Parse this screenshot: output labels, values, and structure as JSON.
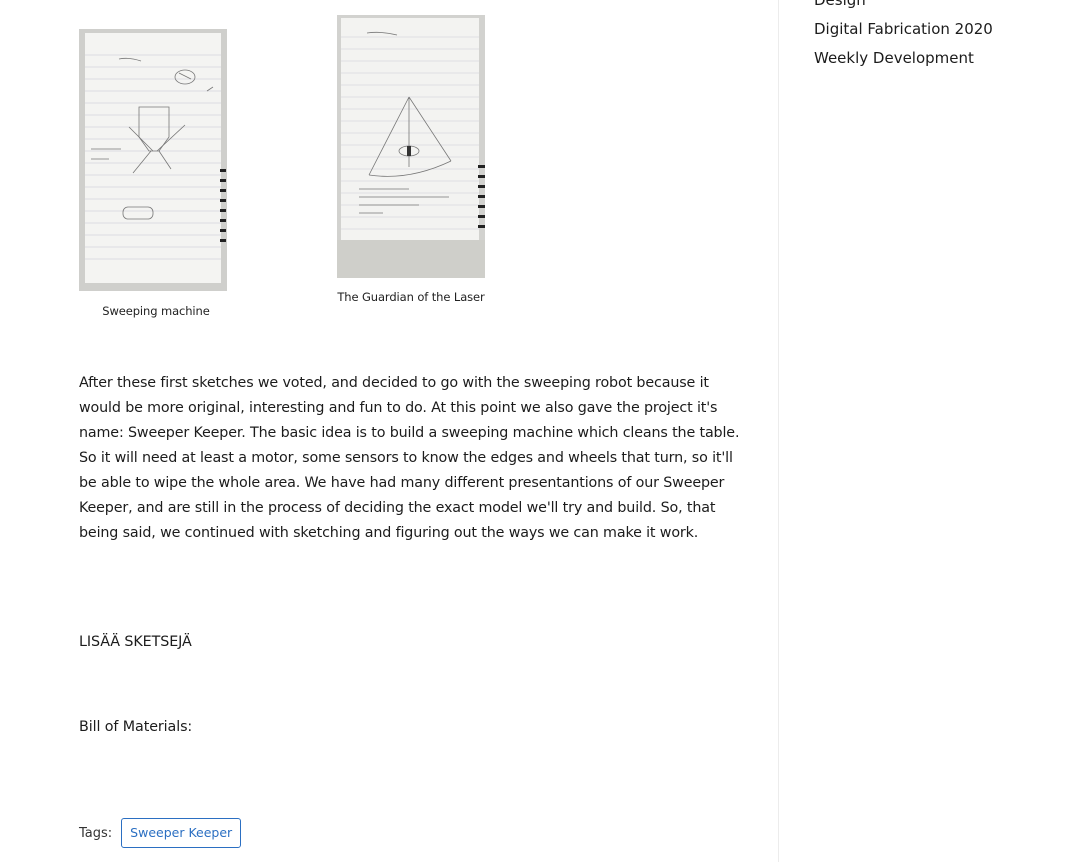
{
  "figures": [
    {
      "caption": "Sweeping machine",
      "image_icon": "notebook-sketch-sweeper"
    },
    {
      "caption": "The Guardian of the Laser",
      "image_icon": "notebook-sketch-pyramid"
    }
  ],
  "article": {
    "paragraph": "After these first sketches we voted, and decided to go with the sweeping robot because it would be more original, interesting and fun to do. At this point we also gave the project it's name: Sweeper Keeper. The basic idea is to build a sweeping machine which cleans the table. So it will need at least a motor, some sensors to know the edges and wheels that turn, so it'll be able to wipe the whole area. We have had many different presentantions of our Sweeper Keeper, and are still in the process of deciding the exact model we'll try and build. So, that being said, we continued with sketching and figuring out the ways we can make it work.",
    "more_sketches": "LISÄÄ SKETSEJÄ",
    "bill_of_materials": "Bill of Materials:"
  },
  "tags": {
    "label": "Tags:",
    "items": [
      "Sweeper Keeper"
    ]
  },
  "sidebar": {
    "items": [
      "Design",
      "Digital Fabrication 2020",
      "Weekly Development"
    ]
  },
  "colors": {
    "accent": "#2b6fc2",
    "divider": "#ececec"
  }
}
